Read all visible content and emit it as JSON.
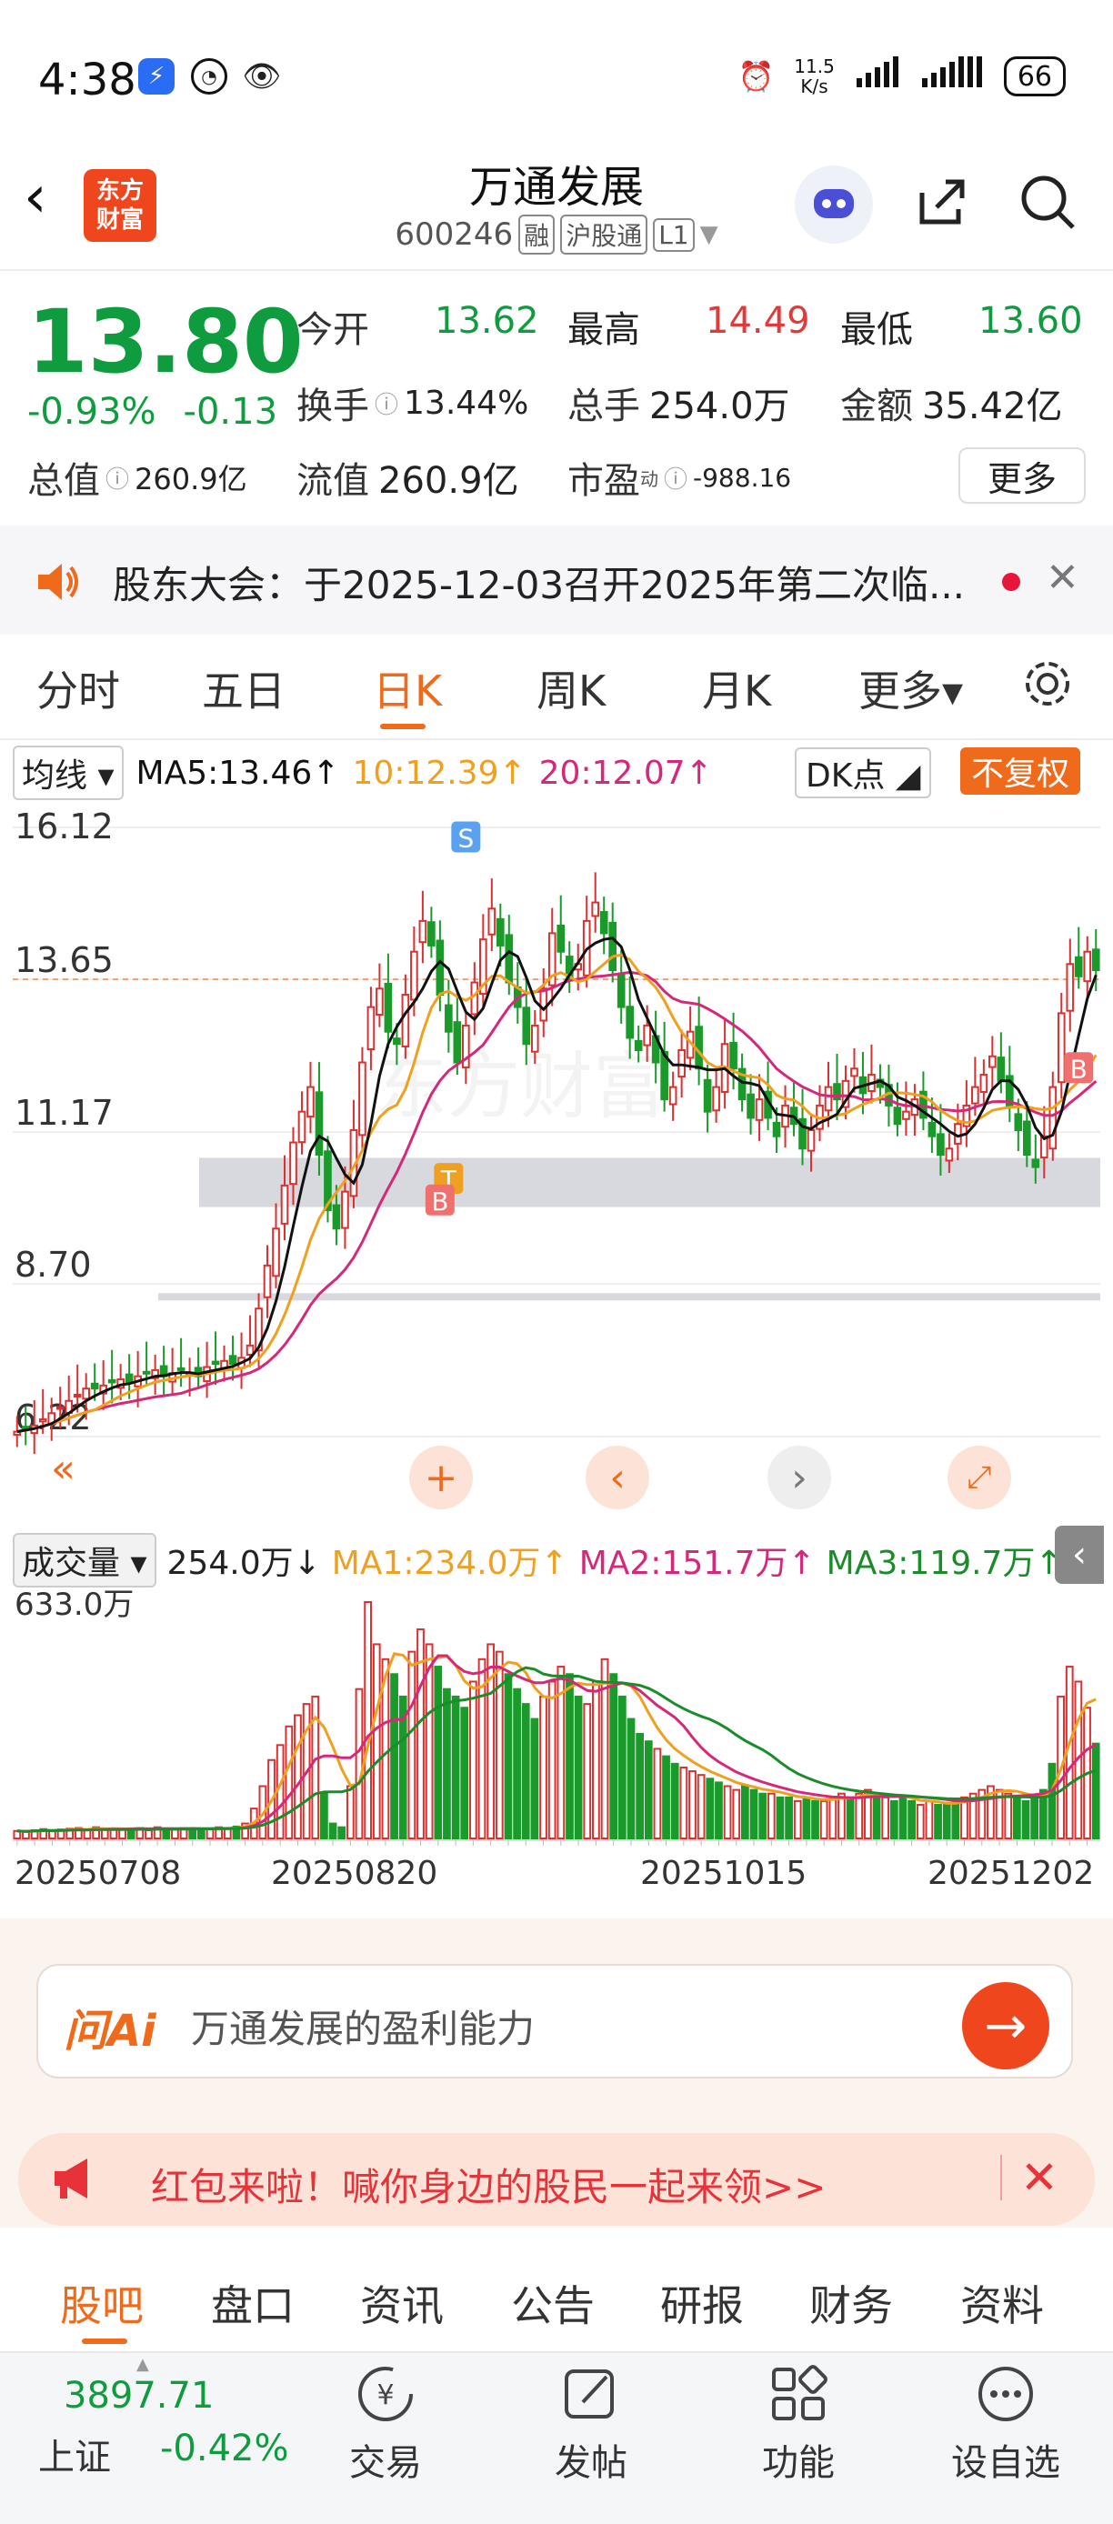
{
  "status": {
    "time": "4:38",
    "net_speed_value": "11.5",
    "net_speed_unit": "K/s",
    "battery": "66"
  },
  "header": {
    "logo_line1": "东方",
    "logo_line2": "财富",
    "title": "万通发展",
    "code": "600246",
    "tags": [
      "融",
      "沪股通",
      "L1"
    ]
  },
  "quote": {
    "price": "13.80",
    "change_pct": "-0.93%",
    "change_amt": "-0.13",
    "stats": [
      {
        "label": "今开",
        "value": "13.62",
        "tone": "green"
      },
      {
        "label": "最高",
        "value": "14.49",
        "tone": "red"
      },
      {
        "label": "最低",
        "value": "13.60",
        "tone": "green"
      },
      {
        "label": "换手",
        "value": "13.44%",
        "tone": "plain"
      },
      {
        "label": "总手",
        "value": "254.0万",
        "tone": "plain"
      },
      {
        "label": "金额",
        "value": "35.42亿",
        "tone": "plain"
      },
      {
        "label": "总值",
        "value": "260.9亿",
        "tone": "plain"
      },
      {
        "label": "流值",
        "value": "260.9亿",
        "tone": "plain"
      },
      {
        "label": "市盈",
        "value": "-988.16",
        "tone": "plain"
      }
    ],
    "pe_superscript": "动",
    "more_label": "更多"
  },
  "announcement": {
    "text": "股东大会：于2025-12-03召开2025年第二次临..."
  },
  "period_tabs": [
    {
      "label": "分时",
      "active": false
    },
    {
      "label": "五日",
      "active": false
    },
    {
      "label": "日K",
      "active": true
    },
    {
      "label": "周K",
      "active": false
    },
    {
      "label": "月K",
      "active": false
    },
    {
      "label": "更多▾",
      "active": false
    }
  ],
  "ma_row": {
    "selector": "均线",
    "ma5": "MA5:13.46↑",
    "ma10": "10:12.39↑",
    "ma20": "20:12.07↑",
    "dk": "DK点",
    "adjust": "不复权",
    "colors": {
      "ma5": "#111111",
      "ma10": "#f0a020",
      "ma20": "#d6287a"
    }
  },
  "price_axis": [
    "16.12",
    "13.65",
    "11.17",
    "8.70",
    "6.22"
  ],
  "markers": [
    "S",
    "T",
    "B",
    "B"
  ],
  "watermark": "东方财富",
  "volume_row": {
    "selector": "成交量",
    "vol": "254.0万↓",
    "ma1": "MA1:234.0万↑",
    "ma2": "MA2:151.7万↑",
    "ma3": "MA3:119.7万↑",
    "colors": {
      "ma1": "#f0a020",
      "ma2": "#d6287a",
      "ma3": "#1a8c2a"
    }
  },
  "vol_axis_max": "633.0万",
  "dates": [
    "20250708",
    "20250820",
    "20251015",
    "20251202"
  ],
  "chart_data": {
    "type": "candlestick",
    "ylim": [
      6.22,
      16.12
    ],
    "note_axis": "price",
    "x_start": "20250708",
    "x_end": "20251202",
    "close": [
      6.3,
      6.35,
      6.4,
      6.5,
      6.6,
      6.7,
      6.8,
      6.9,
      7.0,
      7.0,
      7.05,
      7.1,
      7.15,
      7.1,
      7.2,
      7.25,
      7.3,
      7.2,
      7.25,
      7.3,
      7.25,
      7.2,
      7.35,
      7.4,
      7.45,
      7.4,
      7.5,
      7.7,
      8.3,
      9.0,
      9.6,
      10.3,
      11.0,
      11.5,
      11.9,
      10.8,
      9.9,
      9.6,
      10.2,
      11.2,
      12.3,
      13.2,
      13.5,
      12.8,
      12.6,
      13.4,
      14.1,
      14.6,
      14.2,
      13.4,
      12.8,
      12.3,
      12.9,
      13.6,
      14.3,
      14.8,
      14.2,
      13.6,
      13.2,
      12.6,
      12.9,
      13.5,
      14.4,
      14.1,
      13.7,
      13.9,
      14.6,
      14.9,
      14.4,
      13.8,
      13.2,
      12.7,
      12.5,
      12.9,
      12.3,
      11.7,
      11.9,
      12.5,
      12.8,
      12.2,
      11.5,
      11.9,
      12.6,
      12.2,
      11.7,
      11.4,
      11.7,
      11.4,
      11.1,
      11.6,
      11.3,
      10.9,
      11.2,
      11.6,
      11.9,
      11.7,
      12.0,
      12.2,
      11.8,
      12.1,
      11.9,
      11.6,
      11.3,
      11.5,
      11.7,
      11.4,
      11.1,
      10.8,
      10.9,
      11.3,
      11.6,
      11.9,
      12.1,
      12.4,
      12.0,
      11.6,
      11.2,
      10.8,
      10.6,
      11.1,
      11.9,
      13.1,
      13.9,
      13.7,
      14.1,
      13.8
    ],
    "volume_wan": [
      20,
      18,
      22,
      25,
      20,
      24,
      26,
      28,
      22,
      30,
      25,
      27,
      24,
      26,
      28,
      22,
      30,
      26,
      25,
      28,
      27,
      24,
      26,
      30,
      28,
      32,
      40,
      80,
      140,
      210,
      250,
      300,
      330,
      360,
      380,
      120,
      40,
      30,
      140,
      400,
      633,
      520,
      480,
      440,
      380,
      500,
      560,
      520,
      460,
      400,
      380,
      350,
      420,
      480,
      520,
      500,
      440,
      400,
      360,
      320,
      380,
      420,
      460,
      440,
      380,
      360,
      420,
      480,
      440,
      380,
      320,
      280,
      260,
      240,
      220,
      200,
      190,
      180,
      170,
      160,
      150,
      140,
      130,
      140,
      130,
      120,
      120,
      110,
      110,
      100,
      110,
      100,
      100,
      110,
      120,
      110,
      120,
      130,
      120,
      110,
      100,
      110,
      100,
      90,
      100,
      90,
      90,
      100,
      110,
      120,
      130,
      140,
      130,
      120,
      110,
      100,
      110,
      130,
      200,
      380,
      460,
      420,
      350,
      254
    ],
    "ma5_last": 13.46,
    "ma10_last": 12.39,
    "ma20_last": 12.07
  },
  "ai": {
    "logo": "问Ai",
    "placeholder": "万通发展的盈利能力"
  },
  "promo": {
    "text": "红包来啦！喊你身边的股民一起来领>>"
  },
  "bottom_tabs": [
    {
      "label": "股吧",
      "active": true
    },
    {
      "label": "盘口",
      "active": false
    },
    {
      "label": "资讯",
      "active": false
    },
    {
      "label": "公告",
      "active": false
    },
    {
      "label": "研报",
      "active": false
    },
    {
      "label": "财务",
      "active": false
    },
    {
      "label": "资料",
      "active": false
    }
  ],
  "nav": {
    "index_value": "3897.71",
    "index_name": "上证",
    "index_change": "-0.42%",
    "items": [
      {
        "label": "交易",
        "icon": "yen-icon"
      },
      {
        "label": "发帖",
        "icon": "compose-icon"
      },
      {
        "label": "功能",
        "icon": "grid-icon"
      },
      {
        "label": "设自选",
        "icon": "more-dots-icon"
      }
    ]
  }
}
